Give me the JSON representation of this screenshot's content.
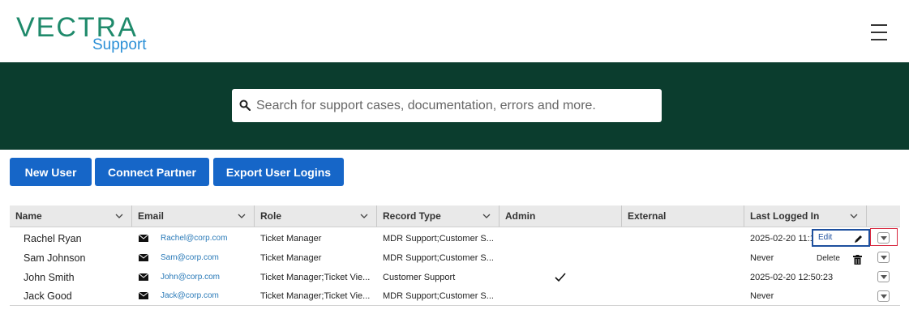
{
  "brand": {
    "word": "VECTRA",
    "sub": "Support"
  },
  "search": {
    "placeholder": "Search for support cases, documentation, errors and more."
  },
  "actions": {
    "new_user": "New User",
    "connect_partner": "Connect Partner",
    "export_user_logins": "Export User Logins"
  },
  "table": {
    "headers": [
      "Name",
      "Email",
      "Role",
      "Record Type",
      "Admin",
      "External",
      "Last Logged In"
    ],
    "rows": [
      {
        "name": "Rachel  Ryan",
        "email": "Rachel@corp.com",
        "role": "Ticket Manager",
        "record_type": "MDR Support;Customer S...",
        "admin": false,
        "external": "",
        "last_logged_in": "2025-02-20 11:1"
      },
      {
        "name": "Sam Johnson",
        "email": "Sam@corp.com",
        "role": "Ticket Manager",
        "record_type": "MDR Support;Customer S...",
        "admin": false,
        "external": "",
        "last_logged_in": "Never"
      },
      {
        "name": "John Smith",
        "email": "John@corp.com",
        "role": "Ticket Manager;Ticket Vie...",
        "record_type": "Customer Support",
        "admin": true,
        "external": "",
        "last_logged_in": "2025-02-20 12:50:23"
      },
      {
        "name": "Jack Good",
        "email": "Jack@corp.com",
        "role": "Ticket Manager;Ticket Vie...",
        "record_type": "MDR Support;Customer S...",
        "admin": false,
        "external": "",
        "last_logged_in": "Never"
      }
    ]
  },
  "row_menu": {
    "edit": "Edit",
    "delete": "Delete"
  },
  "colors": {
    "hero_bg": "#0b3d2e",
    "button_bg": "#1666c8",
    "brand_green": "#1f8a6b",
    "brand_blue": "#2a8fd6",
    "highlight": "#d7263d"
  }
}
